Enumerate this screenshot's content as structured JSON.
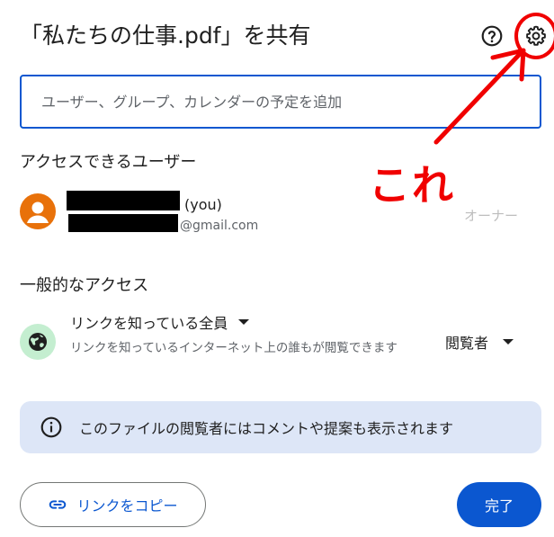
{
  "dialog": {
    "title": "「私たちの仕事.pdf」を共有",
    "help_icon": "help-circle-icon",
    "settings_icon": "gear-icon"
  },
  "search": {
    "placeholder": "ユーザー、グループ、カレンダーの予定を追加"
  },
  "people_section": {
    "heading": "アクセスできるユーザー",
    "users": [
      {
        "name_suffix": "(you)",
        "email_suffix": "@gmail.com",
        "role": "オーナー",
        "avatar_icon": "person-icon"
      }
    ]
  },
  "general_access": {
    "heading": "一般的なアクセス",
    "icon": "globe-icon",
    "mode": "リンクを知っている全員",
    "description": "リンクを知っているインターネット上の誰もが閲覧できます",
    "role": "閲覧者"
  },
  "info": {
    "icon": "info-icon",
    "text": "このファイルの閲覧者にはコメントや提案も表示されます"
  },
  "actions": {
    "copy_link_icon": "link-icon",
    "copy_link": "リンクをコピー",
    "done": "完了"
  },
  "annotation": {
    "text": "これ",
    "color": "#f00000"
  },
  "colors": {
    "accent": "#0b57d0",
    "avatar": "#e8710a",
    "globe_bg": "#c4eed0",
    "info_bg": "#dde6f7"
  }
}
